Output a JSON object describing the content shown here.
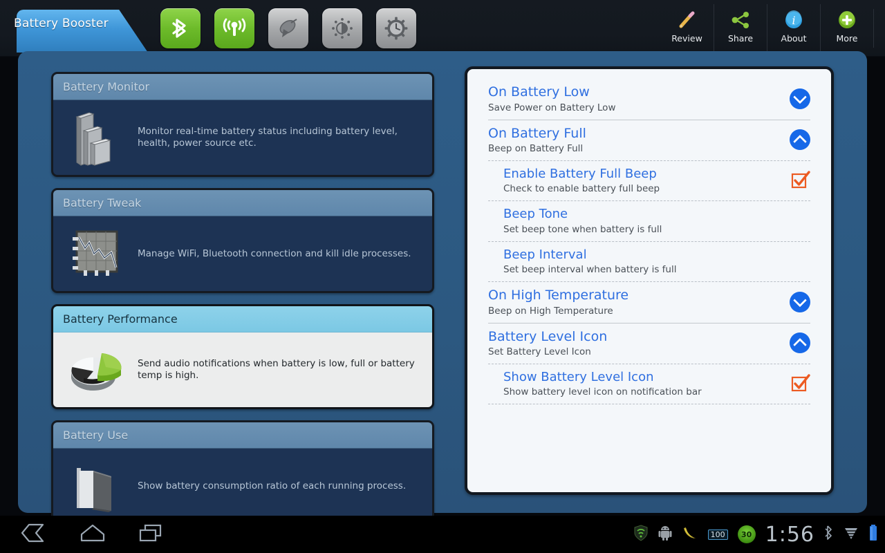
{
  "app": {
    "title": "Battery Booster"
  },
  "toggles": [
    {
      "name": "bluetooth-toggle",
      "state": "on"
    },
    {
      "name": "wifi-toggle",
      "state": "on"
    },
    {
      "name": "gps-toggle",
      "state": "off"
    },
    {
      "name": "brightness-toggle",
      "state": "off"
    },
    {
      "name": "screen-timeout-toggle",
      "state": "off"
    }
  ],
  "actions": [
    {
      "label": "Review",
      "icon": "pencil-icon"
    },
    {
      "label": "Share",
      "icon": "share-icon"
    },
    {
      "label": "About",
      "icon": "info-icon"
    },
    {
      "label": "More",
      "icon": "plus-icon"
    }
  ],
  "cards": [
    {
      "title": "Battery Monitor",
      "desc": "Monitor real-time battery status including battery level, health, power source etc.",
      "icon": "steps-blocks-icon",
      "selected": false
    },
    {
      "title": "Battery Tweak",
      "desc": "Manage WiFi, Bluetooth connection and kill idle processes.",
      "icon": "line-chart-icon",
      "selected": false
    },
    {
      "title": "Battery Performance",
      "desc": "Send audio notifications when battery is low, full or battery temp is high.",
      "icon": "pie-chart-icon",
      "selected": true
    },
    {
      "title": "Battery Use",
      "desc": "Show battery consumption ratio of each running process.",
      "icon": "folder-icon",
      "selected": false
    }
  ],
  "prefs": [
    {
      "title": "On Battery Low",
      "sub": "Save Power on Battery Low",
      "level": "parent",
      "control": "chevron-down",
      "sep": "solid"
    },
    {
      "title": "On Battery Full",
      "sub": "Beep on Battery Full",
      "level": "parent",
      "control": "chevron-up",
      "sep": "dash"
    },
    {
      "title": "Enable Battery Full Beep",
      "sub": "Check to enable battery full beep",
      "level": "child",
      "control": "checkbox-checked",
      "sep": "dash"
    },
    {
      "title": "Beep Tone",
      "sub": "Set beep tone when battery is full",
      "level": "child",
      "control": "none",
      "sep": "dash"
    },
    {
      "title": "Beep Interval",
      "sub": "Set beep interval when battery is full",
      "level": "child",
      "control": "none",
      "sep": "dash"
    },
    {
      "title": "On High Temperature",
      "sub": "Beep on High Temperature",
      "level": "parent",
      "control": "chevron-down",
      "sep": "solid"
    },
    {
      "title": "Battery Level Icon",
      "sub": "Set Battery Level Icon",
      "level": "parent",
      "control": "chevron-up",
      "sep": "dash"
    },
    {
      "title": "Show Battery Level Icon",
      "sub": "Show battery level icon on notification bar",
      "level": "child",
      "control": "checkbox-checked",
      "sep": "dash"
    }
  ],
  "statusbar": {
    "time": "1:56",
    "battery_badge": "100",
    "temp_badge": "30",
    "icons": [
      "shield-wifi-icon",
      "android-robot-icon",
      "banana-icon",
      "battery-percent-icon",
      "temperature-gauge-icon",
      "bluetooth-icon",
      "signal-icon",
      "battery-icon"
    ]
  },
  "navbar": {
    "items": [
      "back-icon",
      "home-icon",
      "recents-icon"
    ]
  },
  "colors": {
    "accent_blue": "#2f6fe0",
    "chevron_blue": "#1668e8",
    "checkbox_orange": "#ec5b22",
    "toggle_on_green": "#6dbb2a",
    "content_bg": "#2e5d88",
    "card_body": "#1d3354",
    "selected_header": "#7bc8e4"
  }
}
